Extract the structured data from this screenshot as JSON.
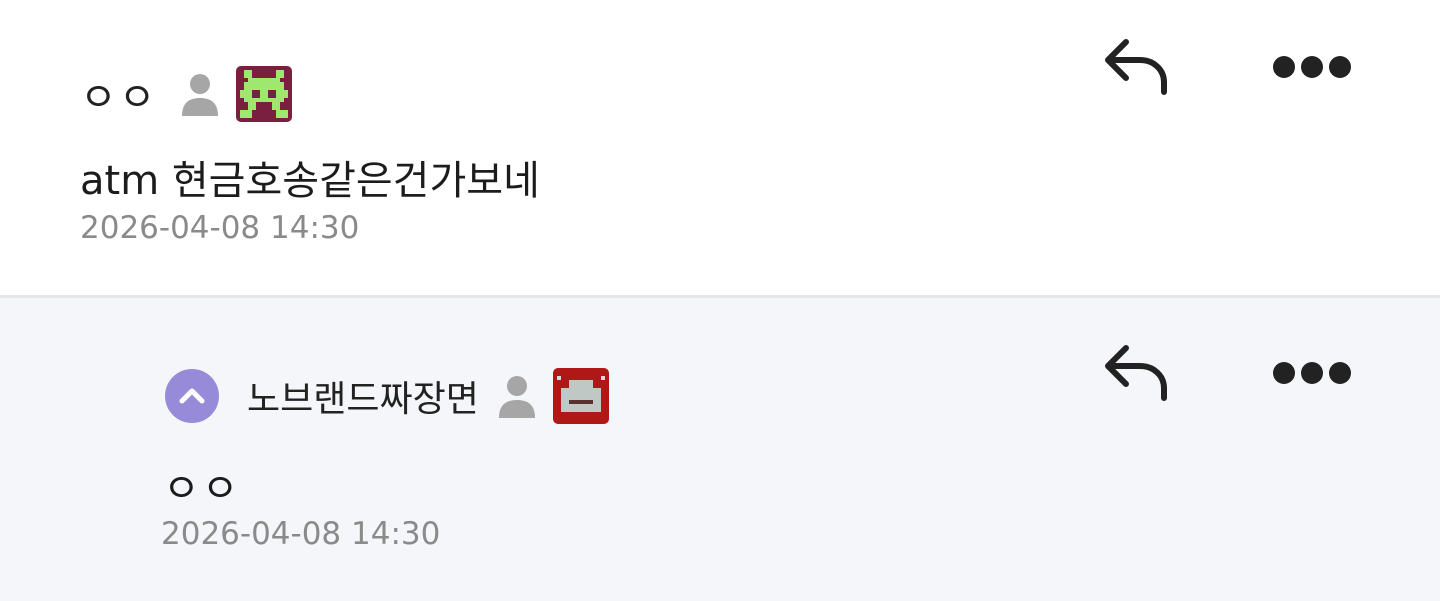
{
  "comments": [
    {
      "nickname": "ㅇㅇ",
      "body": "atm 현금호송같은건가보네",
      "timestamp": "2026-04-08 14:30",
      "level_icon_color": "#7a1f3d",
      "level_icon_accent": "#9fe870"
    },
    {
      "nickname": "노브랜드짜장면",
      "body": "ㅇㅇ",
      "timestamp": "2026-04-08 14:30",
      "level_icon_color": "#b01818",
      "level_icon_accent": "#bfc8c4"
    }
  ],
  "icons": {
    "reply": "reply-arrow-icon",
    "more": "more-dots-icon",
    "user": "user-icon",
    "collapse": "chevron-up-icon"
  },
  "colors": {
    "background": "#ffffff",
    "reply_background": "#f5f6f9",
    "divider": "#e4e7ec",
    "timestamp": "#8a8a8a",
    "collapse_button": "#978bd9"
  }
}
